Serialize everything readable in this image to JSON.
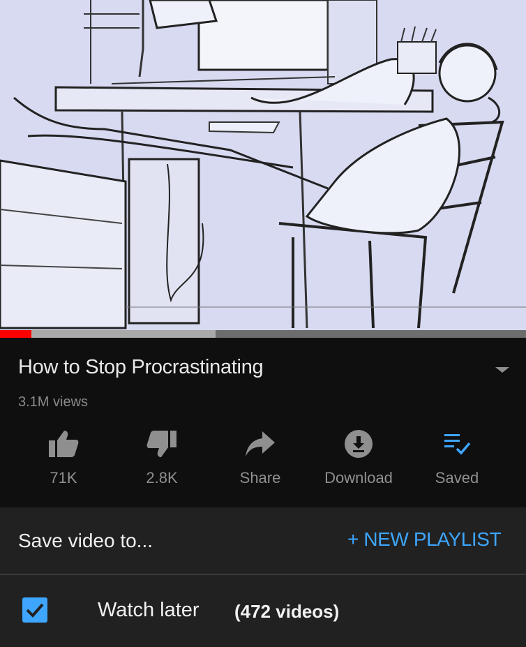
{
  "player": {
    "progress_played": 0.06,
    "progress_buffered": 0.41,
    "progress_color": "#ff0000"
  },
  "video": {
    "title": "How to Stop Procrastinating",
    "views": "3.1M views",
    "expand_icon": "chevron-down-icon"
  },
  "actions": [
    {
      "label": "71K",
      "icon": "thumbs-up-icon"
    },
    {
      "label": "2.8K",
      "icon": "thumbs-down-icon"
    },
    {
      "label": "Share",
      "icon": "share-icon"
    },
    {
      "label": "Download",
      "icon": "download-icon"
    },
    {
      "label": "Saved",
      "icon": "playlist-saved-icon"
    }
  ],
  "save_sheet": {
    "title": "Save video to...",
    "new_playlist": "+ NEW PLAYLIST",
    "playlists": [
      {
        "name": "Watch later",
        "count": "(472 videos)",
        "checked": true
      }
    ]
  },
  "colors": {
    "accent": "#3ea6ff",
    "background": "#0f0f0f",
    "sheet": "#212121"
  }
}
